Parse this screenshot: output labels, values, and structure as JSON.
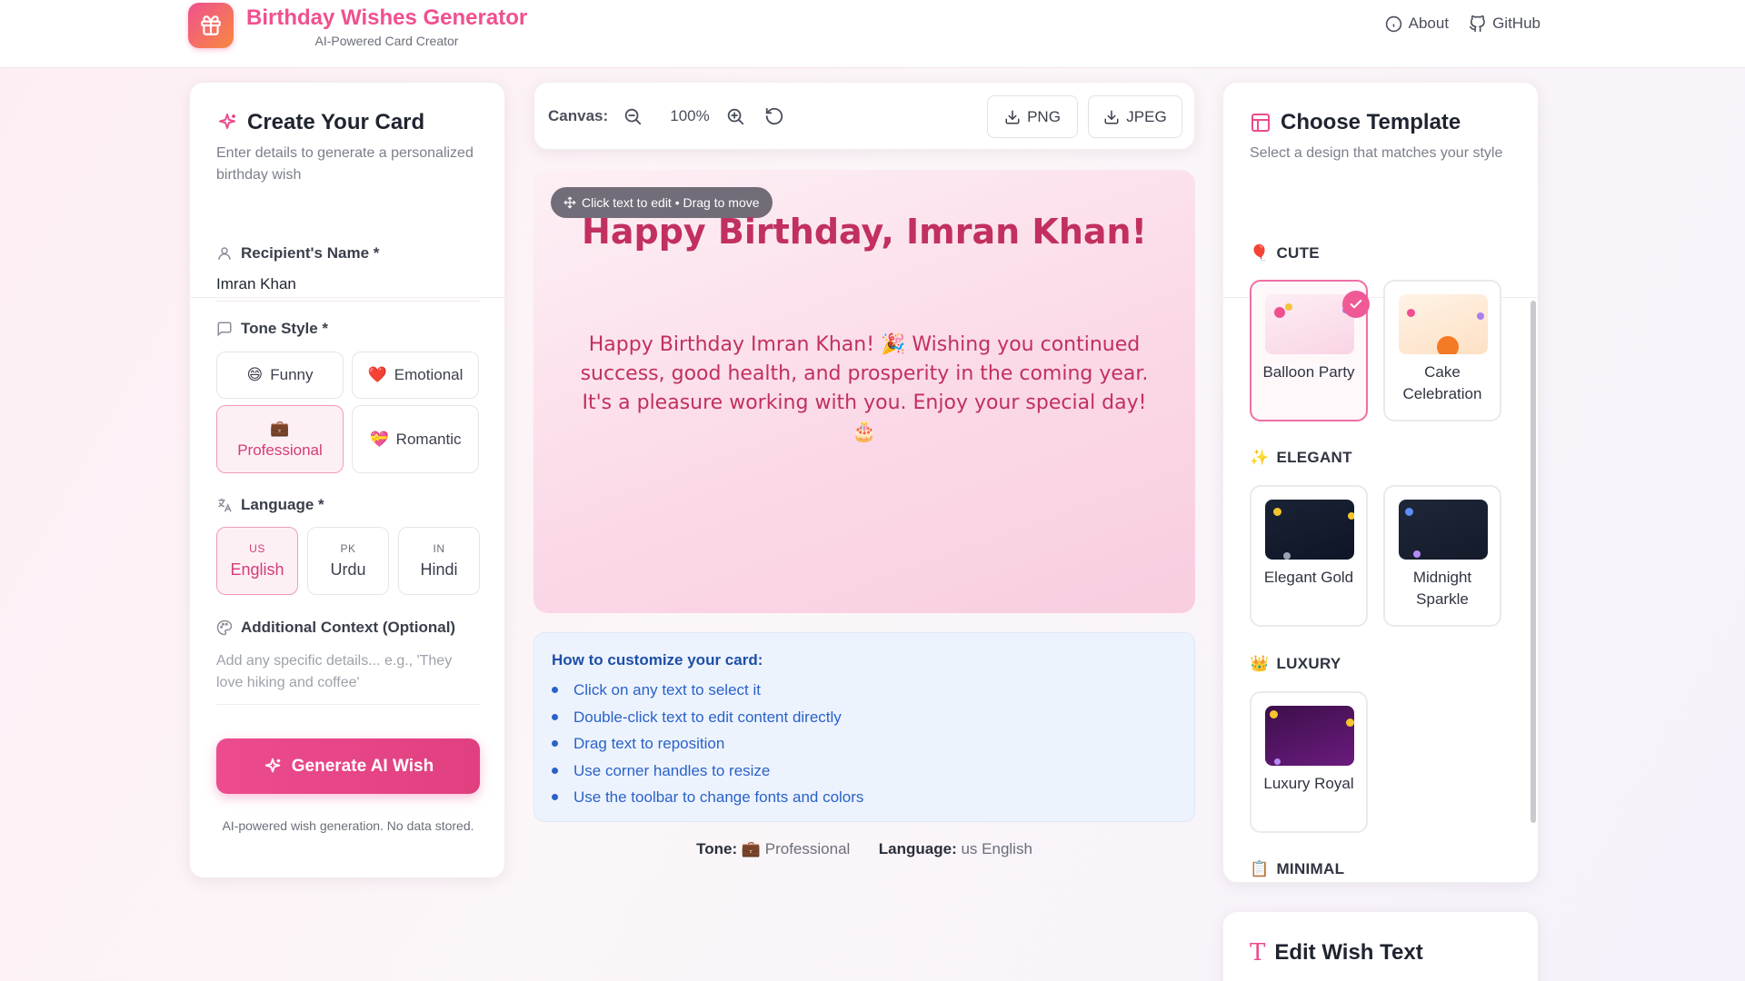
{
  "header": {
    "title": "Birthday Wishes Generator",
    "subtitle": "AI-Powered Card Creator",
    "nav": {
      "about": "About",
      "github": "GitHub"
    }
  },
  "left_panel": {
    "title": "Create Your Card",
    "description": "Enter details to generate a personalized birthday wish",
    "recipient": {
      "label": "Recipient's Name *",
      "value": "Imran Khan"
    },
    "tone": {
      "label": "Tone Style *",
      "options": [
        {
          "emoji": "😄",
          "label": "Funny"
        },
        {
          "emoji": "❤️",
          "label": "Emotional"
        },
        {
          "emoji": "💼",
          "label": "Professional"
        },
        {
          "emoji": "💝",
          "label": "Romantic"
        }
      ],
      "selected": "Professional"
    },
    "language": {
      "label": "Language *",
      "options": [
        {
          "code": "US",
          "name": "English"
        },
        {
          "code": "PK",
          "name": "Urdu"
        },
        {
          "code": "IN",
          "name": "Hindi"
        }
      ],
      "selected": "English"
    },
    "context": {
      "label": "Additional Context (Optional)",
      "placeholder": "Add any specific details... e.g., 'They love hiking and coffee'"
    },
    "generate_button": "Generate AI Wish",
    "note": "AI-powered wish generation. No data stored."
  },
  "toolbar": {
    "label": "Canvas:",
    "zoom": "100%",
    "png_button": "PNG",
    "jpeg_button": "JPEG"
  },
  "preview": {
    "hint": "Click text to edit • Drag to move",
    "title": "Happy Birthday, Imran Khan!",
    "body": "Happy Birthday Imran Khan! 🎉 Wishing you continued success, good health, and prosperity in the coming year. It's a pleasure working with you. Enjoy your special day! 🎂"
  },
  "howto": {
    "title": "How to customize your card:",
    "items": [
      "Click on any text to select it",
      "Double-click text to edit content directly",
      "Drag text to reposition",
      "Use corner handles to resize",
      "Use the toolbar to change fonts and colors"
    ]
  },
  "meta": {
    "tone_label": "Tone:",
    "tone_emoji": "💼",
    "tone_value": "Professional",
    "language_label": "Language:",
    "language_value": "us English"
  },
  "right_panel": {
    "title": "Choose Template",
    "description": "Select a design that matches your style",
    "categories": [
      {
        "icon": "🎈",
        "label": "CUTE",
        "templates": [
          "Balloon Party",
          "Cake Celebration"
        ]
      },
      {
        "icon": "✨",
        "label": "ELEGANT",
        "templates": [
          "Elegant Gold",
          "Midnight Sparkle"
        ]
      },
      {
        "icon": "👑",
        "label": "LUXURY",
        "templates": [
          "Luxury Royal"
        ]
      },
      {
        "icon": "📋",
        "label": "MINIMAL",
        "templates": []
      }
    ],
    "selected_template": "Balloon Party"
  },
  "edit_card": {
    "title": "Edit Wish Text"
  },
  "colors": {
    "brand_pink": "#f0508f",
    "brand_orange": "#f7893f",
    "accent_text": "#c1305f",
    "howto_blue": "#2a62c9"
  }
}
